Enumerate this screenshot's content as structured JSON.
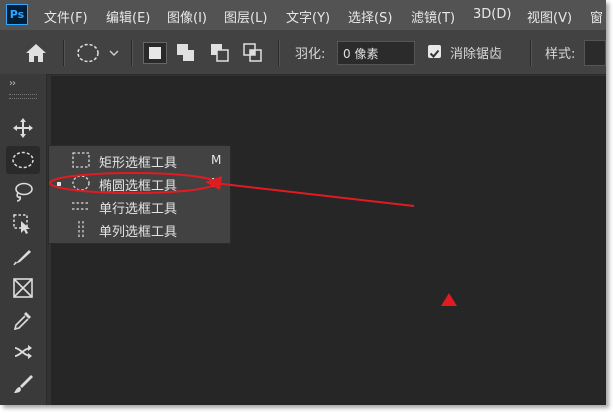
{
  "app": {
    "logo": "Ps"
  },
  "menubar": {
    "items": [
      {
        "label": "文件(F)"
      },
      {
        "label": "编辑(E)"
      },
      {
        "label": "图像(I)"
      },
      {
        "label": "图层(L)"
      },
      {
        "label": "文字(Y)"
      },
      {
        "label": "选择(S)"
      },
      {
        "label": "滤镜(T)"
      },
      {
        "label": "3D(D)"
      },
      {
        "label": "视图(V)"
      },
      {
        "label": "窗"
      }
    ]
  },
  "options_bar": {
    "feather_label": "羽化:",
    "feather_value": "0 像素",
    "anti_alias_label": "消除锯齿",
    "anti_alias_checked": true,
    "style_label": "样式:"
  },
  "toolbar": {
    "tools": [
      {
        "icon": "move-icon"
      },
      {
        "icon": "elliptical-marquee-icon",
        "active": true
      },
      {
        "icon": "lasso-icon"
      },
      {
        "icon": "object-selection-icon"
      },
      {
        "icon": "pen-knife-icon"
      },
      {
        "icon": "frame-icon"
      },
      {
        "icon": "eyedropper-icon"
      },
      {
        "icon": "healing-icon"
      },
      {
        "icon": "brush-icon"
      }
    ]
  },
  "flyout": {
    "items": [
      {
        "label": "矩形选框工具",
        "shortcut": "M",
        "icon": "rectangular-marquee-icon",
        "selected": false
      },
      {
        "label": "椭圆选框工具",
        "shortcut": "M",
        "icon": "elliptical-marquee-icon",
        "selected": true
      },
      {
        "label": "单行选框工具",
        "shortcut": "",
        "icon": "single-row-marquee-icon",
        "selected": false
      },
      {
        "label": "单列选框工具",
        "shortcut": "",
        "icon": "single-column-marquee-icon",
        "selected": false
      }
    ]
  },
  "annotation": {
    "color": "#e11b22"
  }
}
